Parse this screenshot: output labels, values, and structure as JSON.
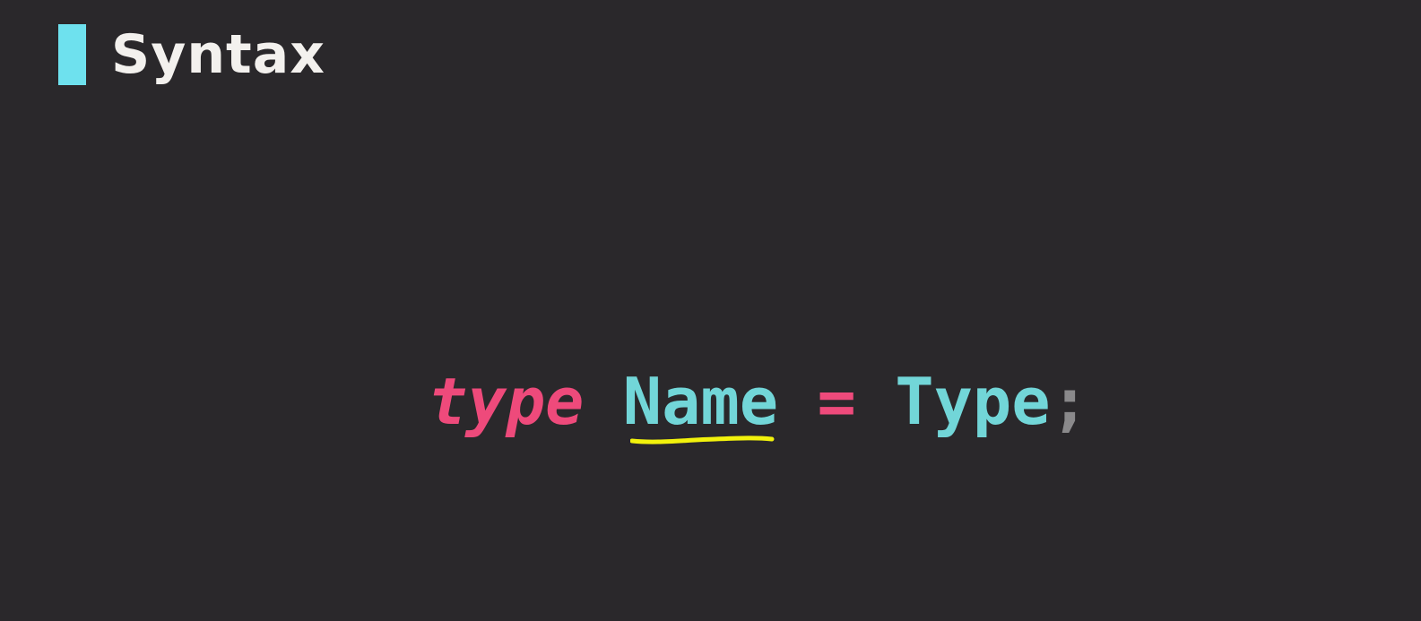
{
  "slide": {
    "title": "Syntax",
    "accent_color": "#6ee1ee",
    "background_color": "#2a282b"
  },
  "code": {
    "keyword": "type",
    "name": "Name",
    "operator": "=",
    "type": "Type",
    "terminator": ";",
    "colors": {
      "keyword": "#ee4a7b",
      "identifier": "#72d6d8",
      "punctuation": "#8a898b",
      "highlight": "#f2f20c"
    }
  }
}
